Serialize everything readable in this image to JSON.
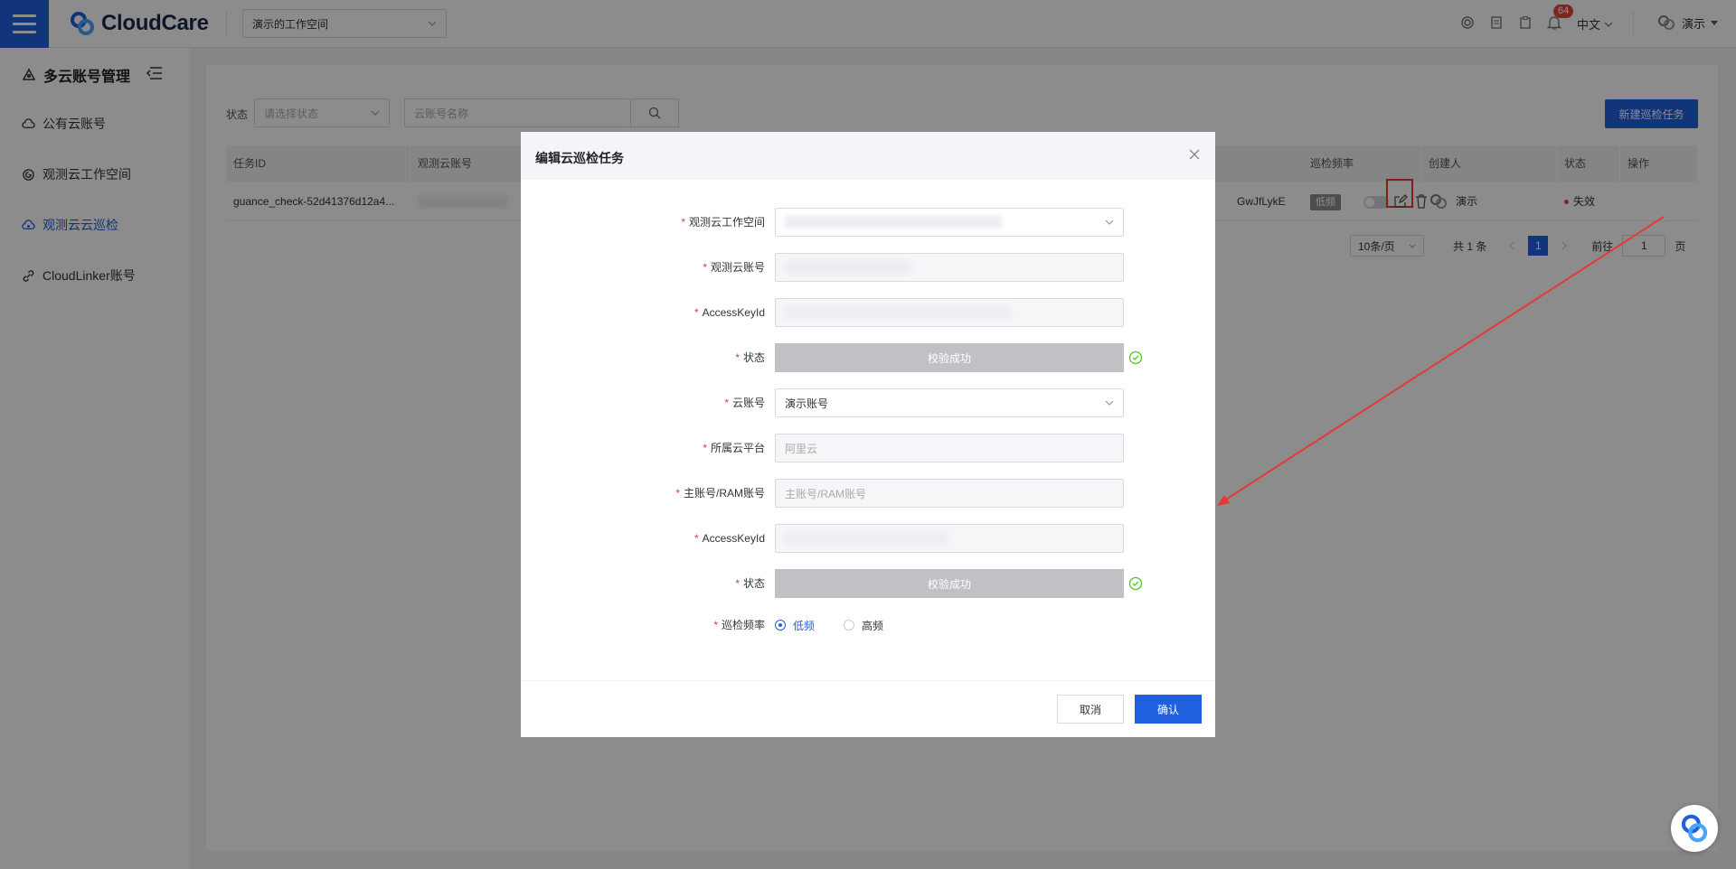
{
  "header": {
    "brand": "CloudCare",
    "workspace": "演示的工作空间",
    "notification_count": "64",
    "language": "中文",
    "user_name": "演示"
  },
  "sidebar": {
    "title": "多云账号管理",
    "items": [
      {
        "label": "公有云账号",
        "icon": "cloud-icon"
      },
      {
        "label": "观测云工作空间",
        "icon": "guance-icon"
      },
      {
        "label": "观测云云巡检",
        "icon": "cloud-check-icon",
        "active": true
      },
      {
        "label": "CloudLinker账号",
        "icon": "link-icon"
      }
    ]
  },
  "filters": {
    "status_label": "状态",
    "status_placeholder": "请选择状态",
    "search_placeholder": "云账号名称",
    "new_button": "新建巡检任务"
  },
  "table": {
    "headers": {
      "task_id": "任务ID",
      "account": "观测云账号",
      "freq": "巡检频率",
      "creator": "创建人",
      "status": "状态",
      "actions": "操作"
    },
    "rows": [
      {
        "task_id": "guance_check-52d41376d12a4...",
        "ak_tail": "GwJfLykE",
        "freq": "低频",
        "creator": "演示",
        "status": "失效"
      }
    ]
  },
  "pagination": {
    "page_size": "10条/页",
    "total": "共 1 条",
    "current": "1",
    "goto_label": "前往",
    "goto_value": "1",
    "page_suffix": "页"
  },
  "modal": {
    "title": "编辑云巡检任务",
    "fields": {
      "workspace_label": "观测云工作空间",
      "account_label": "观测云账号",
      "ak1_label": "AccessKeyId",
      "status1_label": "状态",
      "verify1": "校验成功",
      "cloud_account_label": "云账号",
      "cloud_account_value": "演示账号",
      "platform_label": "所属云平台",
      "platform_value": "阿里云",
      "main_account_label": "主账号/RAM账号",
      "main_account_placeholder": "主账号/RAM账号",
      "ak2_label": "AccessKeyId",
      "status2_label": "状态",
      "verify2": "校验成功",
      "freq_label": "巡检频率",
      "freq_low": "低频",
      "freq_high": "高频"
    },
    "cancel": "取消",
    "confirm": "确认"
  },
  "colors": {
    "primary": "#1f5fe0",
    "danger": "#e53935",
    "success": "#52c41a"
  }
}
